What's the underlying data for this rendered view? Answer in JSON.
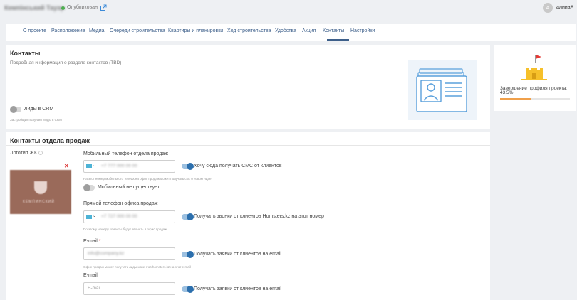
{
  "header": {
    "project_title": "Кемпінський Тауэр",
    "status": "Опубликован",
    "user_initial": "A",
    "user_name": "алина"
  },
  "tabs": [
    {
      "label": "О проекте"
    },
    {
      "label": "Расположение"
    },
    {
      "label": "Медиа"
    },
    {
      "label": "Очереди строительства"
    },
    {
      "label": "Квартиры и планировки"
    },
    {
      "label": "Ход строительства"
    },
    {
      "label": "Удобства"
    },
    {
      "label": "Акция"
    },
    {
      "label": "Контакты",
      "active": true
    },
    {
      "label": "Настройки"
    }
  ],
  "contacts": {
    "title": "Контакты",
    "subtitle": "Подробная информация о разделе контактов (TBD)",
    "crm_toggle_label": "Лиды в CRM",
    "crm_hint": "Застройщик получает лиды в CRM"
  },
  "side": {
    "completion_label": "Завершение профиля проекта:",
    "completion_value": "43.5%",
    "completion_fraction": 0.435,
    "progress_color": "#f0a04b"
  },
  "sales": {
    "title": "Контакты отдела продаж",
    "logo_label": "Логотип ЖК",
    "logo_caption": "КЕМПИНСКИЙ",
    "mobile": {
      "label": "Мобильный телефон отдела продаж",
      "value": "+7 777 000 00 00",
      "sms_toggle_label": "Хочу сюда получать СМС от клиентов",
      "hint": "На этот номер мобильного телефона офис продаж может получать смс о новом лиде",
      "not_exist_label": "Мобильный не существует"
    },
    "office": {
      "label": "Прямой телефон офиса продаж",
      "value": "+7 727 000 00 00",
      "calls_toggle_label": "Получать звонки от клиентов Homsters.kz на этот номер",
      "hint": "По этому номеру клиенты будут звонить в офис продаж"
    },
    "email1": {
      "label": "E-mail",
      "required_mark": "*",
      "value": "info@company.kz",
      "toggle_label": "Получать заявки от клиентов на email",
      "hint": "Офис продаж может получать лиды клиентов homsters.kz на этот e-mail"
    },
    "email2": {
      "label": "E-mail",
      "placeholder": "E-mail",
      "toggle_label": "Получать заявки от клиентов на email"
    }
  }
}
